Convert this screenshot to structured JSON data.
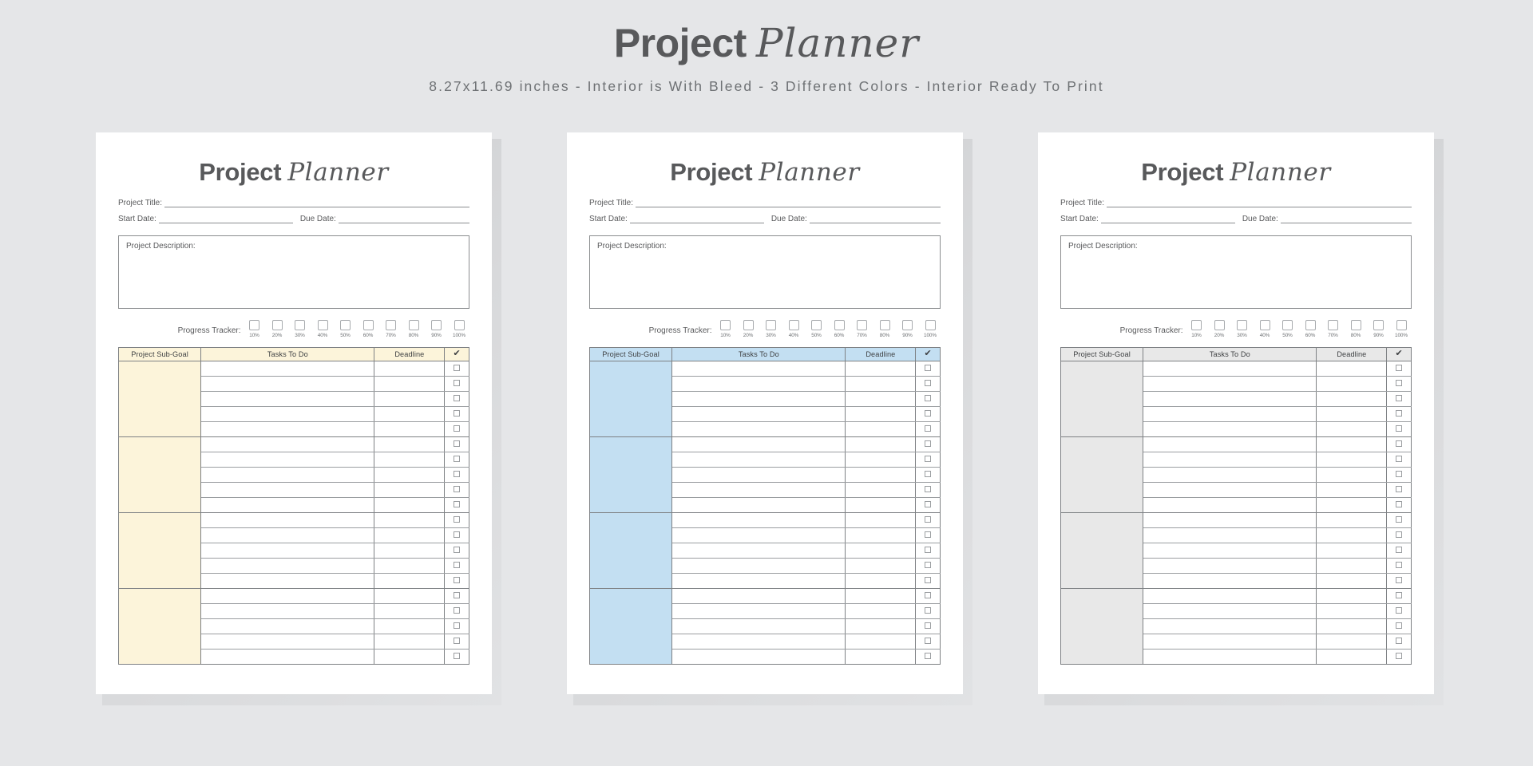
{
  "banner": {
    "title_bold": "Project",
    "title_script": "Planner",
    "subtitle": "8.27x11.69 inches - Interior is With Bleed - 3 Different Colors - Interior Ready To Print"
  },
  "page": {
    "title_bold": "Project",
    "title_script": "Planner",
    "project_title_label": "Project Title:",
    "start_date_label": "Start Date:",
    "due_date_label": "Due Date:",
    "description_label": "Project Description:",
    "progress_label": "Progress Tracker:",
    "progress_steps": [
      "10%",
      "20%",
      "30%",
      "40%",
      "50%",
      "60%",
      "70%",
      "80%",
      "90%",
      "100%"
    ],
    "table": {
      "headers": [
        "Project Sub-Goal",
        "Tasks To Do",
        "Deadline",
        "✔"
      ],
      "sub_goal_blocks": 4,
      "rows_per_block": 5,
      "total_rows": 20
    }
  },
  "variants": [
    {
      "id": "cream",
      "theme_class": "theme-cream",
      "accent": "#fcf4da"
    },
    {
      "id": "blue",
      "theme_class": "theme-blue",
      "accent": "#c3dff2"
    },
    {
      "id": "gray",
      "theme_class": "theme-gray",
      "accent": "#e8e8e8"
    }
  ],
  "colors": {
    "background": "#e5e6e8",
    "page": "#ffffff",
    "ink": "#58595b",
    "rule": "#8b8d8f"
  }
}
